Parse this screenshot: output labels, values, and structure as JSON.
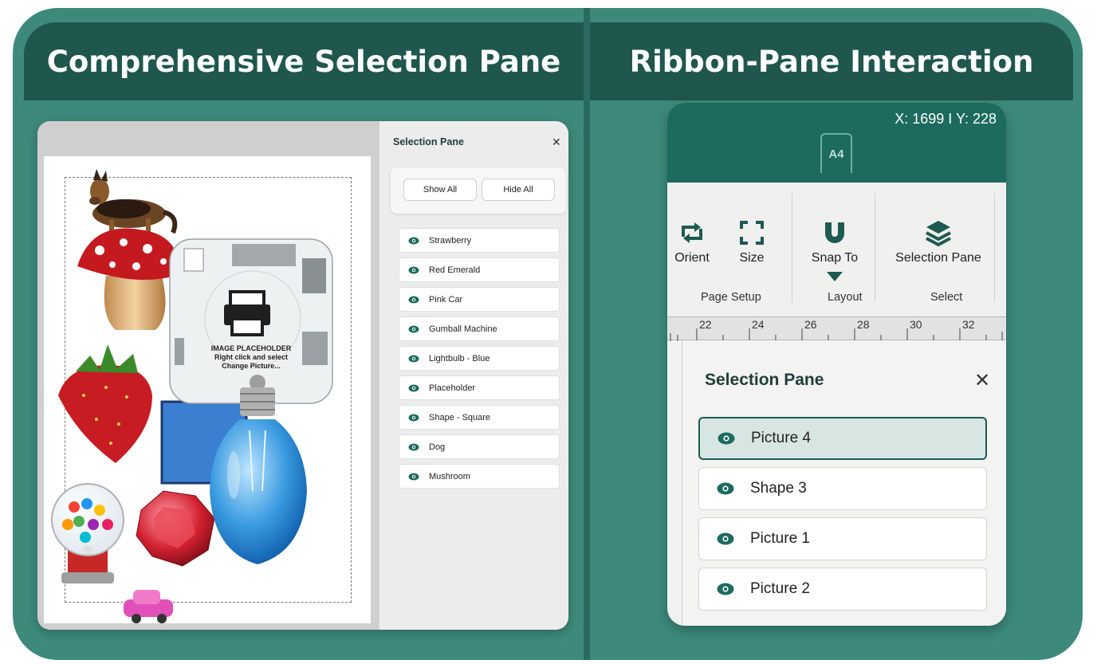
{
  "headers": {
    "left": "Comprehensive Selection Pane",
    "right": "Ribbon-Pane Interaction"
  },
  "left_panel": {
    "placeholder": {
      "line1": "IMAGE PLACEHOLDER",
      "line2": "Right click and select",
      "line3": "Change Picture..."
    },
    "selection_pane": {
      "title": "Selection Pane",
      "close_icon": "close-icon",
      "show_all": "Show All",
      "hide_all": "Hide All",
      "items": [
        {
          "label": "Strawberry",
          "icon": "eye-icon"
        },
        {
          "label": "Red Emerald",
          "icon": "eye-icon"
        },
        {
          "label": "Pink Car",
          "icon": "eye-icon"
        },
        {
          "label": "Gumball Machine",
          "icon": "eye-icon"
        },
        {
          "label": "Lightbulb - Blue",
          "icon": "eye-icon"
        },
        {
          "label": "Placeholder",
          "icon": "eye-icon"
        },
        {
          "label": "Shape - Square",
          "icon": "eye-icon"
        },
        {
          "label": "Dog",
          "icon": "eye-icon"
        },
        {
          "label": "Mushroom",
          "icon": "eye-icon"
        }
      ]
    }
  },
  "right_panel": {
    "coordinates": "X: 1699 I Y: 228",
    "tab": "A4",
    "ribbon": {
      "buttons": {
        "orient": "Orient",
        "size": "Size",
        "snap_to": "Snap To",
        "selection_pane": "Selection Pane"
      },
      "groups": {
        "page_setup": "Page Setup",
        "layout": "Layout",
        "select": "Select"
      }
    },
    "ruler": [
      "22",
      "24",
      "26",
      "28",
      "30",
      "32"
    ],
    "selection_pane": {
      "title": "Selection Pane",
      "close_icon": "close-icon",
      "items": [
        {
          "label": "Picture 4",
          "selected": true
        },
        {
          "label": "Shape 3",
          "selected": false
        },
        {
          "label": "Picture 1",
          "selected": false
        },
        {
          "label": "Picture 2",
          "selected": false
        }
      ]
    }
  },
  "colors": {
    "frame": "#3d8a7d",
    "header": "#1f574e",
    "accent": "#1d6a5f",
    "selected_row": "#d8e6e3"
  }
}
